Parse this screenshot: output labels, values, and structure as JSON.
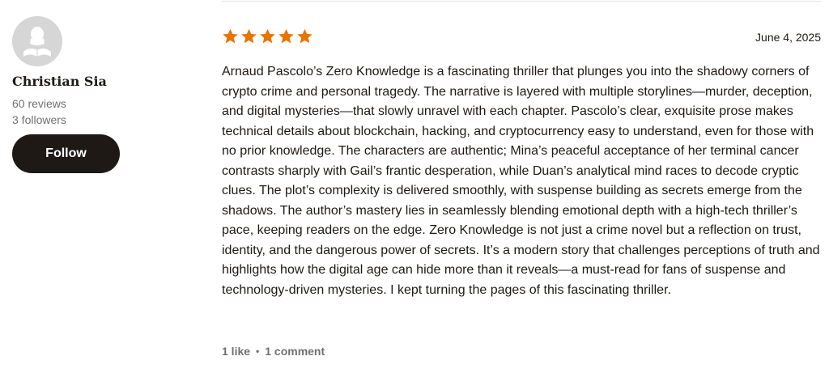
{
  "reviewer": {
    "name": "Christian Sia",
    "reviews": "60 reviews",
    "followers": "3 followers",
    "follow_label": "Follow"
  },
  "review": {
    "rating": 5,
    "star_color": "#e87400",
    "date": "June 4, 2025",
    "text": "Arnaud Pascolo’s Zero Knowledge is a fascinating thriller that plunges you into the shadowy corners of crypto crime and personal tragedy. The narrative is layered with multiple storylines—murder, deception, and digital mysteries—that slowly unravel with each chapter. Pascolo’s clear, exquisite prose makes technical details about blockchain, hacking, and cryptocurrency easy to understand, even for those with no prior knowledge. The characters are authentic; Mina’s peaceful acceptance of her terminal cancer contrasts sharply with Gail’s frantic desperation, while Duan’s analytical mind races to decode cryptic clues. The plot’s complexity is delivered smoothly, with suspense building as secrets emerge from the shadows. The author’s mastery lies in seamlessly blending emotional depth with a high-tech thriller’s pace, keeping readers on the edge. Zero Knowledge is not just a crime novel but a reflection on trust, identity, and the dangerous power of secrets. It’s a modern story that challenges perceptions of truth and highlights how the digital age can hide more than it reveals—a must-read for fans of suspense and technology-driven mysteries. I kept turning the pages of this fascinating thriller.",
    "likes": "1 like",
    "separator": "•",
    "comments": "1 comment"
  },
  "colors": {
    "text": "#1e1915",
    "muted": "#707070",
    "button_bg": "#1e1915"
  }
}
